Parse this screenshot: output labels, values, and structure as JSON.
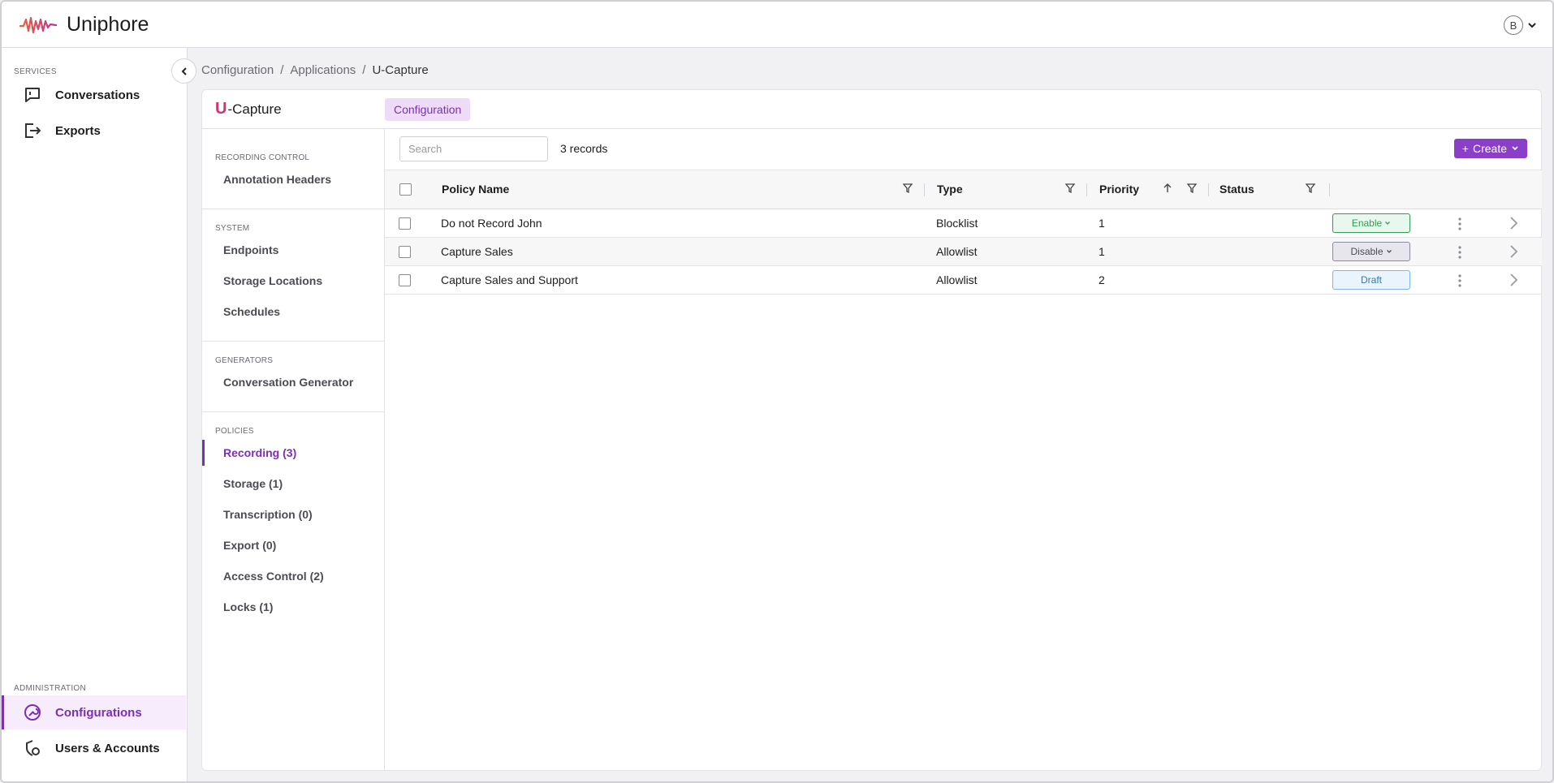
{
  "app": {
    "brand": "Uniphore",
    "user_initial": "B"
  },
  "leftnav": {
    "services_label": "SERVICES",
    "services": [
      {
        "label": "Conversations",
        "icon": "chat-icon"
      },
      {
        "label": "Exports",
        "icon": "export-icon"
      }
    ],
    "admin_label": "ADMINISTRATION",
    "admin": [
      {
        "label": "Configurations",
        "icon": "wrench-icon",
        "active": true
      },
      {
        "label": "Users & Accounts",
        "icon": "shield-user-icon"
      }
    ]
  },
  "breadcrumb": {
    "items": [
      "Configuration",
      "Applications",
      "U-Capture"
    ],
    "separator": "/"
  },
  "app_header": {
    "title_prefix": "U",
    "title": "-Capture",
    "tab": "Configuration"
  },
  "inner_menu": {
    "sections": [
      {
        "label": "RECORDING CONTROL",
        "items": [
          "Annotation Headers"
        ]
      },
      {
        "label": "SYSTEM",
        "items": [
          "Endpoints",
          "Storage Locations",
          "Schedules"
        ]
      },
      {
        "label": "GENERATORS",
        "items": [
          "Conversation Generator"
        ]
      },
      {
        "label": "POLICIES",
        "items": [
          "Recording (3)",
          "Storage (1)",
          "Transcription (0)",
          "Export (0)",
          "Access Control (2)",
          "Locks (1)"
        ]
      }
    ],
    "active": "Recording (3)"
  },
  "toolbar": {
    "search_placeholder": "Search",
    "records": "3 records",
    "create_label": "Create",
    "create_plus": "+"
  },
  "table": {
    "columns": [
      "Policy Name",
      "Type",
      "Priority",
      "Status"
    ],
    "sort": {
      "column": "Priority",
      "direction": "ascending"
    },
    "rows": [
      {
        "name": "Do not Record John",
        "type": "Blocklist",
        "priority": "1",
        "status": "Enable",
        "status_kind": "enable"
      },
      {
        "name": "Capture Sales",
        "type": "Allowlist",
        "priority": "1",
        "status": "Disable",
        "status_kind": "disable"
      },
      {
        "name": "Capture Sales and Support",
        "type": "Allowlist",
        "priority": "2",
        "status": "Draft",
        "status_kind": "draft"
      }
    ]
  },
  "colors": {
    "accent": "#7b2fb5",
    "create_button": "#8b3fc9",
    "enable": "#2f9e55",
    "draft": "#2a7bc4"
  }
}
